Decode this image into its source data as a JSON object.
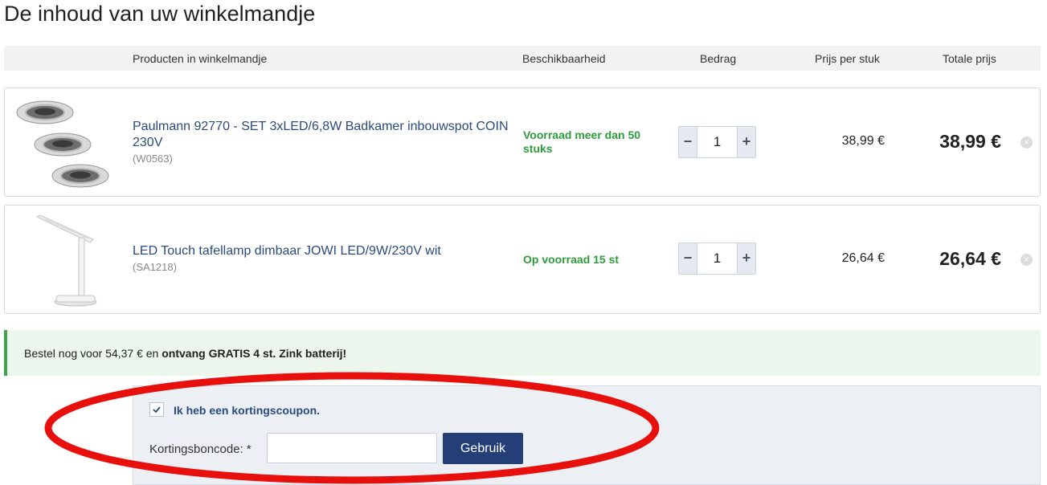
{
  "page": {
    "title": "De inhoud van uw winkelmandje"
  },
  "table_header": {
    "products": "Producten in winkelmandje",
    "availability": "Beschikbaarheid",
    "amount": "Bedrag",
    "unit_price": "Prijs per stuk",
    "total_price": "Totale prijs"
  },
  "cart": {
    "items": [
      {
        "name": "Paulmann 92770 - SET 3xLED/6,8W Badkamer inbouwspot COIN 230V",
        "code": "(W0563)",
        "availability": "Voorraad meer dan 50 stuks",
        "quantity": "1",
        "minus": "−",
        "plus": "+",
        "unit_price": "38,99 €",
        "total_price": "38,99 €",
        "remove": "×",
        "image": "recessed-spotlight-set-icon"
      },
      {
        "name": "LED Touch tafellamp dimbaar JOWI LED/9W/230V wit",
        "code": "(SA1218)",
        "availability": "Op voorraad 15 st",
        "quantity": "1",
        "minus": "−",
        "plus": "+",
        "unit_price": "26,64 €",
        "total_price": "26,64 €",
        "remove": "×",
        "image": "desk-lamp-icon"
      }
    ]
  },
  "promo": {
    "text": "Bestel nog voor 54,37 € en ",
    "bold": "ontvang GRATIS 4 st. Zink batterij!"
  },
  "coupon": {
    "checkbox_label": "Ik heb een kortingscoupon.",
    "checked": true,
    "code_label": "Kortingsboncode: *",
    "code_value": "",
    "submit_label": "Gebruik"
  },
  "colors": {
    "link": "#2a4a7f",
    "in_stock": "#2e9c3c",
    "button": "#243f78",
    "promo_bar": "#44a150",
    "highlight": "#e8100c"
  }
}
